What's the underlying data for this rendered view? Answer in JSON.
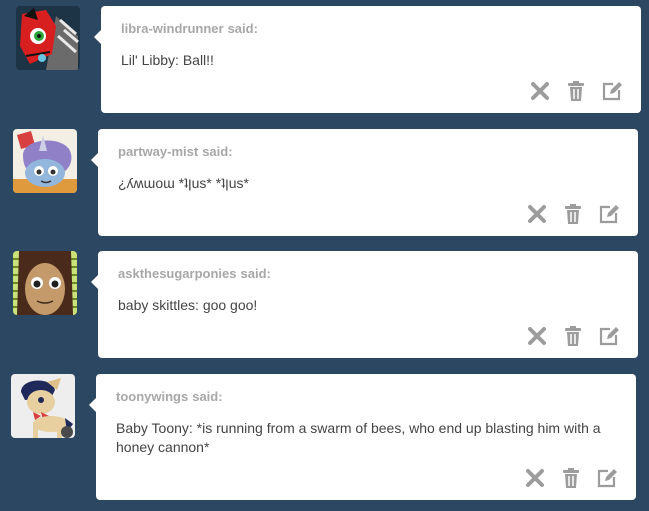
{
  "said_label": "said:",
  "messages": [
    {
      "asker": "libra-windrunner",
      "text": "Lil' Libby: Ball!!",
      "avatar": "red-pony-avatar"
    },
    {
      "asker": "partway-mist",
      "text": "¿ʎʍɯoɯ *ʇןus* *ʇןus*",
      "avatar": "blue-unicorn-avatar"
    },
    {
      "asker": "askthesugarponies",
      "text": "baby skittles: goo goo!",
      "avatar": "brown-pony-avatar"
    },
    {
      "asker": "toonywings",
      "text": "Baby Toony: *is running from a swarm of bees, who end up blasting him with a honey cannon*",
      "avatar": "cream-pegasus-avatar"
    }
  ],
  "actions": {
    "delete": "close-icon",
    "trash": "trash-icon",
    "edit": "edit-icon"
  },
  "colors": {
    "background": "#2c4762",
    "card": "#ffffff",
    "asker": "#a7a7a7",
    "icon": "#9c9c9c"
  }
}
